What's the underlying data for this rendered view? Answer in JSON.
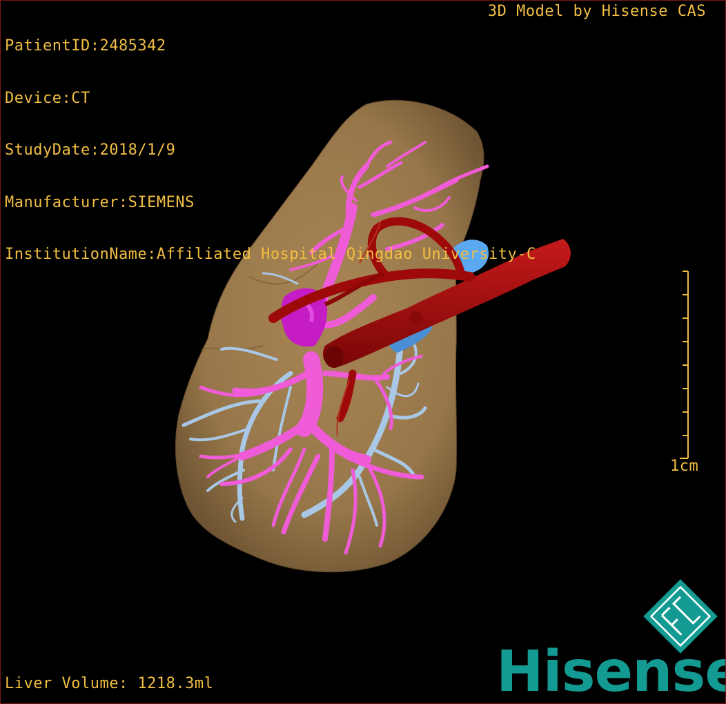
{
  "header": {
    "patient_id": "PatientID:2485342",
    "device": "Device:CT",
    "study_date": "StudyDate:2018/1/9",
    "manufacturer": "Manufacturer:SIEMENS",
    "institution": "InstitutionName:Affiliated Hospital Qingdao University-C"
  },
  "credit": "3D Model by Hisense CAS",
  "scale_bar": {
    "label": "1cm"
  },
  "footer": {
    "liver_volume": "Liver Volume: 1218.3ml"
  },
  "brand": {
    "name": "Hisense",
    "logo_text": "FC"
  },
  "colors": {
    "overlay_text": "#f2bf43",
    "liver": "#9a7a4c",
    "portal_vein": "#f05bd8",
    "hepatic_vein": "#a9c8e6",
    "artery": "#a80c0c",
    "ivc": "#5aa8f0",
    "brand": "#139b93"
  },
  "icons": {
    "logo": "hisense-cas-logo-icon"
  }
}
